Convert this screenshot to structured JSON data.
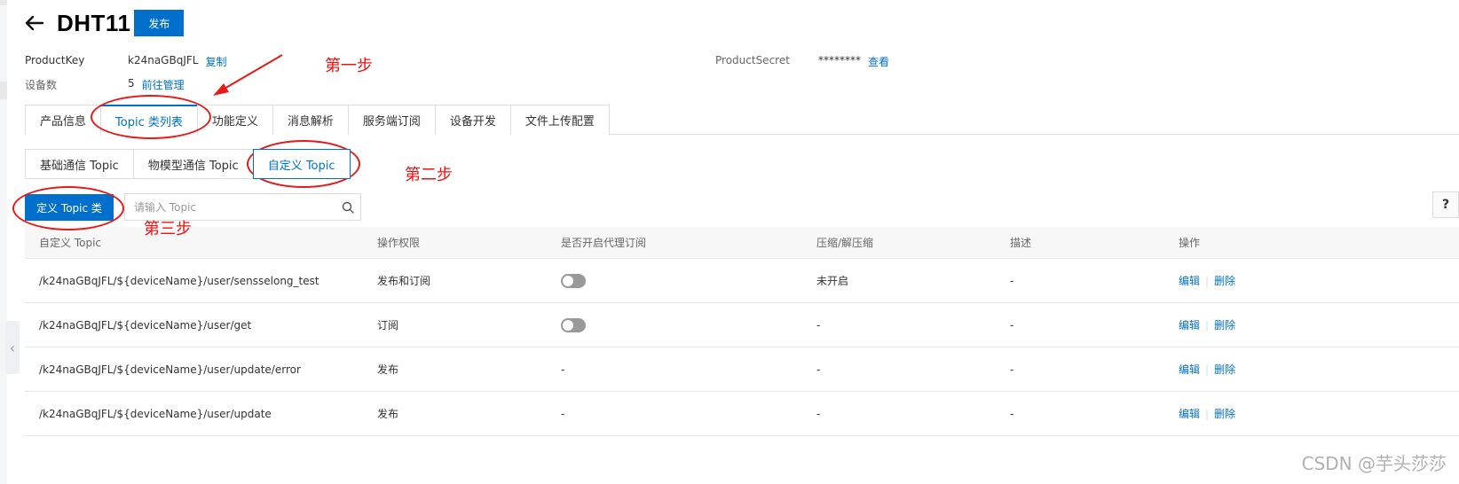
{
  "header": {
    "title": "DHT11",
    "publish_label": "发布"
  },
  "meta": {
    "product_key_label": "ProductKey",
    "product_key_value": "k24naGBqJFL",
    "copy_label": "复制",
    "device_count_label": "设备数",
    "device_count_value": "5",
    "manage_label": "前往管理",
    "product_secret_label": "ProductSecret",
    "product_secret_value": "********",
    "view_label": "查看"
  },
  "main_tabs": [
    {
      "label": "产品信息"
    },
    {
      "label": "Topic 类列表"
    },
    {
      "label": "功能定义"
    },
    {
      "label": "消息解析"
    },
    {
      "label": "服务端订阅"
    },
    {
      "label": "设备开发"
    },
    {
      "label": "文件上传配置"
    }
  ],
  "sub_tabs": [
    {
      "label": "基础通信 Topic"
    },
    {
      "label": "物模型通信 Topic"
    },
    {
      "label": "自定义 Topic"
    }
  ],
  "toolbar": {
    "define_label": "定义 Topic 类",
    "search_placeholder": "请输入 Topic",
    "help_label": "?"
  },
  "table": {
    "headers": [
      "自定义 Topic",
      "操作权限",
      "是否开启代理订阅",
      "压缩/解压缩",
      "描述",
      "操作"
    ],
    "rows": [
      {
        "topic": "/k24naGBqJFL/${deviceName}/user/sensselong_test",
        "permission": "发布和订阅",
        "proxy": "",
        "compress": "未开启",
        "desc": "-"
      },
      {
        "topic": "/k24naGBqJFL/${deviceName}/user/get",
        "permission": "订阅",
        "proxy": "",
        "compress": "-",
        "desc": "-"
      },
      {
        "topic": "/k24naGBqJFL/${deviceName}/user/update/error",
        "permission": "发布",
        "proxy": "-",
        "compress": "-",
        "desc": "-"
      },
      {
        "topic": "/k24naGBqJFL/${deviceName}/user/update",
        "permission": "发布",
        "proxy": "-",
        "compress": "-",
        "desc": "-"
      }
    ],
    "edit_label": "编辑",
    "delete_label": "删除"
  },
  "annotations": {
    "step1": "第一步",
    "step2": "第二步",
    "step3": "第三步"
  },
  "watermark": "CSDN @芋头莎莎",
  "colors": {
    "accent": "#0070cc",
    "annotation": "#e31b1b"
  }
}
